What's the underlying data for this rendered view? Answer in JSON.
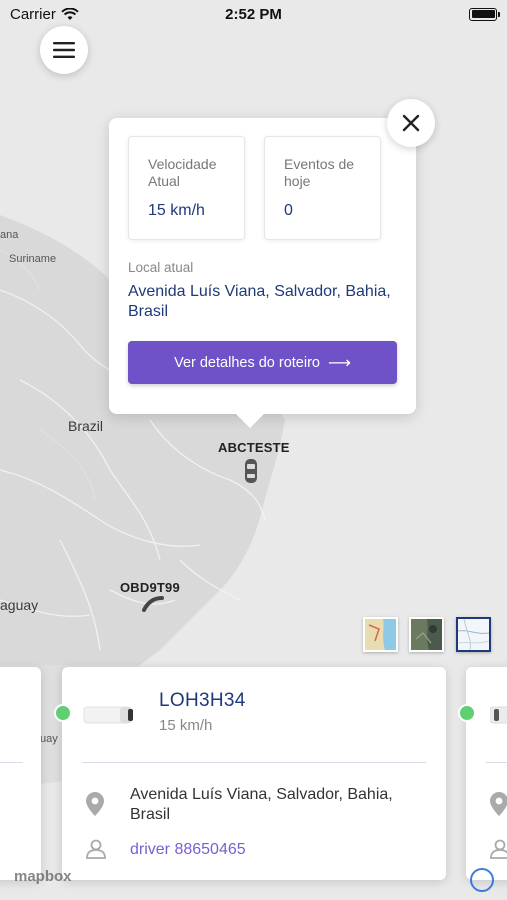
{
  "status_bar": {
    "carrier": "Carrier",
    "time": "2:52 PM"
  },
  "map": {
    "labels": {
      "suriname": "Suriname",
      "guyana_partial": "ana",
      "brazil": "Brazil",
      "paraguay_partial": "aguay",
      "uruguay_partial": "uay"
    },
    "vehicle_labels": {
      "abcteste": "ABCTESTE",
      "obd9t99": "OBD9T99"
    },
    "toggles": [
      "map-streets",
      "map-satellite",
      "map-light"
    ],
    "selected_toggle": "map-light",
    "attribution": "mapbox"
  },
  "popup": {
    "speed_label": "Velocidade Atual",
    "speed_value": "15 km/h",
    "events_label": "Eventos de hoje",
    "events_value": "0",
    "location_label": "Local atual",
    "location_value": "Avenida Luís Viana, Salvador, Bahia, Brasil",
    "details_button": "Ver detalhes do roteiro",
    "arrow_glyph": "⟶"
  },
  "vehicle_card": {
    "plate": "LOH3H34",
    "speed": "15 km/h",
    "address": "Avenida Luís Viana, Salvador, Bahia, Brasil",
    "driver": "driver 88650465",
    "status_color": "#5fcf72"
  },
  "colors": {
    "accent": "#6f52c8",
    "text_blue": "#1e3a7a",
    "online": "#5fcf72"
  }
}
